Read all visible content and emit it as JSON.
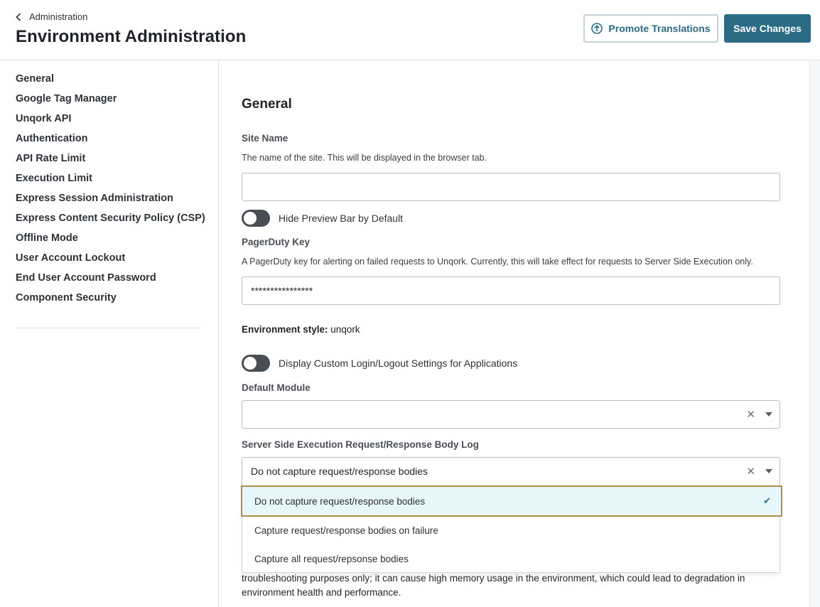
{
  "header": {
    "breadcrumb": "Administration",
    "title": "Environment Administration",
    "promote_label": "Promote Translations",
    "save_label": "Save Changes"
  },
  "sidebar": {
    "items": [
      {
        "label": "General"
      },
      {
        "label": "Google Tag Manager"
      },
      {
        "label": "Unqork API"
      },
      {
        "label": "Authentication"
      },
      {
        "label": "API Rate Limit"
      },
      {
        "label": "Execution Limit"
      },
      {
        "label": "Express Session Administration"
      },
      {
        "label": "Express Content Security Policy (CSP)"
      },
      {
        "label": "Offline Mode"
      },
      {
        "label": "User Account Lockout"
      },
      {
        "label": "End User Account Password"
      },
      {
        "label": "Component Security"
      }
    ]
  },
  "main": {
    "section_title": "General",
    "site_name": {
      "label": "Site Name",
      "description": "The name of the site. This will be displayed in the browser tab.",
      "value": ""
    },
    "hide_preview_bar": {
      "label": "Hide Preview Bar by Default",
      "on": false
    },
    "pagerduty": {
      "label": "PagerDuty Key",
      "description": "A PagerDuty key for alerting on failed requests to Unqork. Currently, this will take effect for requests to Server Side Execution only.",
      "value": "****************"
    },
    "environment_style": {
      "label": "Environment style:",
      "value": "unqork"
    },
    "custom_login": {
      "label": "Display Custom Login/Logout Settings for Applications",
      "on": false
    },
    "default_module": {
      "label": "Default Module",
      "value": ""
    },
    "sse_log": {
      "label": "Server Side Execution Request/Response Body Log",
      "value": "Do not capture request/response bodies",
      "options": [
        {
          "label": "Do not capture request/response bodies",
          "selected": true
        },
        {
          "label": "Capture request/response bodies on failure",
          "selected": false
        },
        {
          "label": "Capture all request/repsonse bodies",
          "selected": false
        }
      ]
    },
    "footnote": "troubleshooting purposes only; it can cause high memory usage in the environment, which could lead to degradation in environment health and performance."
  },
  "icons": {
    "back": "chevron-left-icon",
    "promote": "upload-circle-icon",
    "clear": "close-icon",
    "caret": "caret-down-icon",
    "check": "check-icon"
  },
  "colors": {
    "primary": "#2c6b84",
    "selected_option_bg": "#e6f6f9",
    "focus_border": "#b18f4a",
    "toggle_off": "#494e55"
  }
}
